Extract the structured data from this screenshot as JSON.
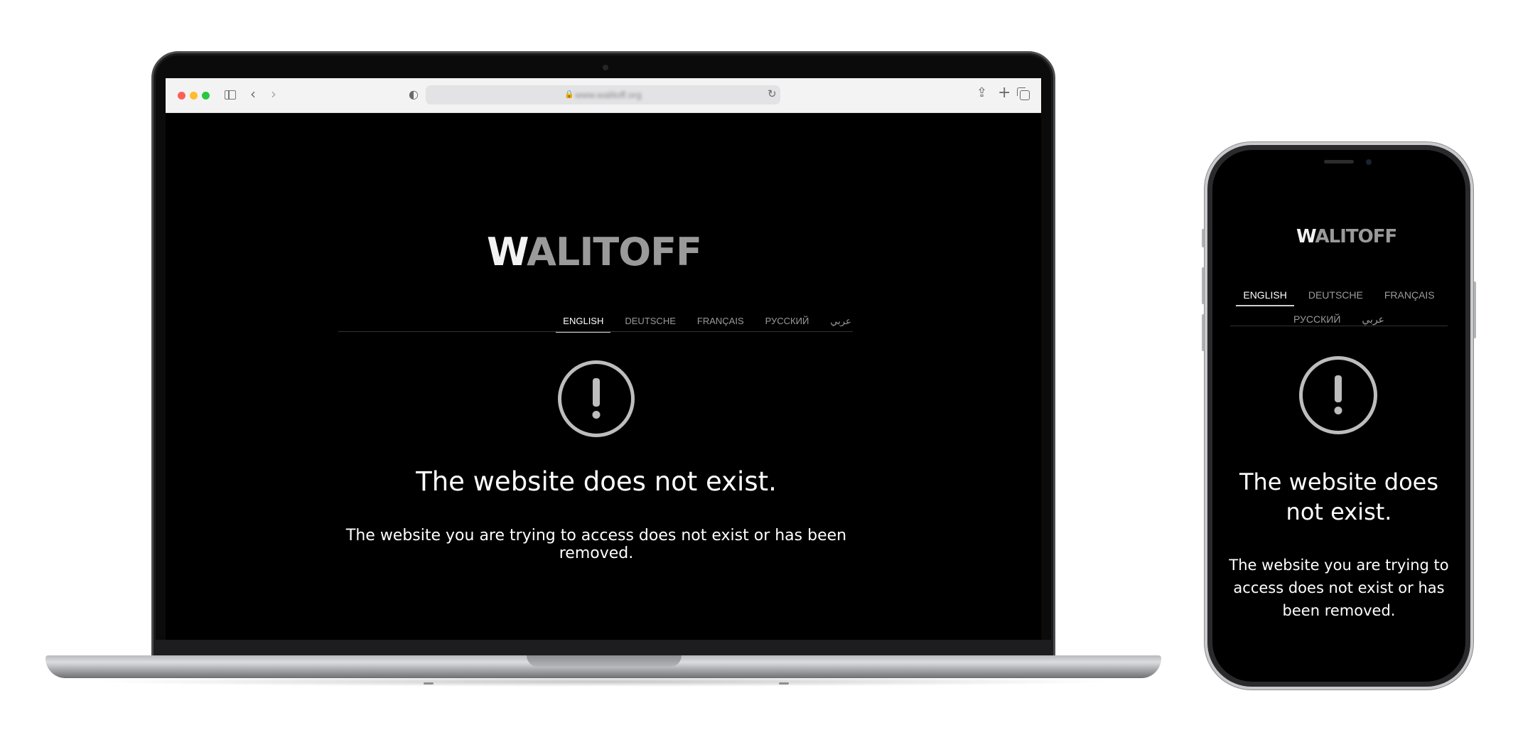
{
  "browser": {
    "url": "www.walitoff.org",
    "icons": {
      "sidebar": "sidebar-icon",
      "back": "chevron-left-icon",
      "forward": "chevron-right-icon",
      "privacy": "shield-icon",
      "lock": "lock-icon",
      "reload": "reload-icon",
      "share": "share-icon",
      "new_tab": "plus-icon",
      "tabs": "tabs-overview-icon"
    },
    "glyphs": {
      "back": "‹",
      "forward": "›",
      "shield": "◐",
      "lock": "🔒",
      "reload": "↻",
      "share": "⇪",
      "plus": "+"
    }
  },
  "site": {
    "logo_first": "W",
    "logo_rest": "ALITOFF",
    "languages": [
      {
        "label": "ENGLISH",
        "active": true
      },
      {
        "label": "DEUTSCHE",
        "active": false
      },
      {
        "label": "FRANÇAIS",
        "active": false
      },
      {
        "label": "РУССКИЙ",
        "active": false
      },
      {
        "label": "عربي",
        "active": false
      }
    ],
    "alert_icon": "exclamation-circle-icon",
    "heading": "The website does not exist.",
    "message": "The website you are trying to access does not exist or has been removed."
  },
  "colors": {
    "page_background": "#000000",
    "logo_accent": "#f2f2f2",
    "logo_muted": "#9a9a9a",
    "text": "#ffffff",
    "nav_inactive": "#9a9a9a",
    "icon": "#bdbdbd"
  }
}
